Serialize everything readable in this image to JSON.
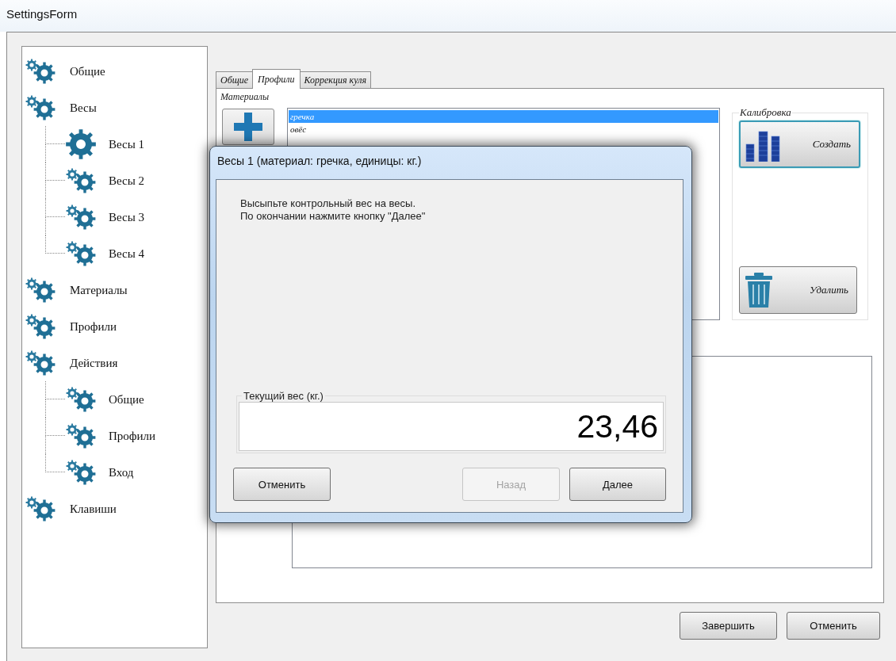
{
  "window": {
    "title": "SettingsForm"
  },
  "tree": [
    {
      "label": "Общие",
      "selected": false
    },
    {
      "label": "Весы",
      "selected": false,
      "children": [
        {
          "label": "Весы 1",
          "selected": true
        },
        {
          "label": "Весы 2",
          "selected": false
        },
        {
          "label": "Весы 3",
          "selected": false
        },
        {
          "label": "Весы 4",
          "selected": false
        }
      ]
    },
    {
      "label": "Материалы",
      "selected": false
    },
    {
      "label": "Профили",
      "selected": false
    },
    {
      "label": "Действия",
      "selected": false,
      "children": [
        {
          "label": "Общие",
          "selected": false
        },
        {
          "label": "Профили",
          "selected": false
        },
        {
          "label": "Вход",
          "selected": false
        }
      ]
    },
    {
      "label": "Клавиши",
      "selected": false
    }
  ],
  "tabs": [
    {
      "label": "Общие",
      "selected": false
    },
    {
      "label": "Профили",
      "selected": true
    },
    {
      "label": "Коррекция куля",
      "selected": false
    }
  ],
  "profiles_tab": {
    "materials_label": "Материалы",
    "materials": [
      {
        "label": "гречка",
        "selected": true
      },
      {
        "label": "овёс",
        "selected": false
      }
    ],
    "calibration": {
      "title": "Калибровка",
      "buttons": [
        {
          "kind": "create",
          "label": "Создать",
          "focused": true
        },
        {
          "kind": "delete",
          "label": "Удалить",
          "focused": false
        }
      ]
    }
  },
  "dialog": {
    "title": "Весы 1 (материал: гречка, единицы: кг.)",
    "message_lines": [
      "Высыпьте контрольный вес на весы.",
      "По окончании нажмите кнопку \"Далее\""
    ],
    "weight": {
      "label": "Текущий вес (кг.)",
      "value": "23,46"
    },
    "buttons": [
      {
        "label": "Отменить",
        "disabled": false
      },
      {
        "label": "Назад",
        "disabled": true
      },
      {
        "label": "Далее",
        "disabled": false
      }
    ]
  },
  "footer_buttons": [
    {
      "label": "Завершить"
    },
    {
      "label": "Отменить"
    }
  ]
}
